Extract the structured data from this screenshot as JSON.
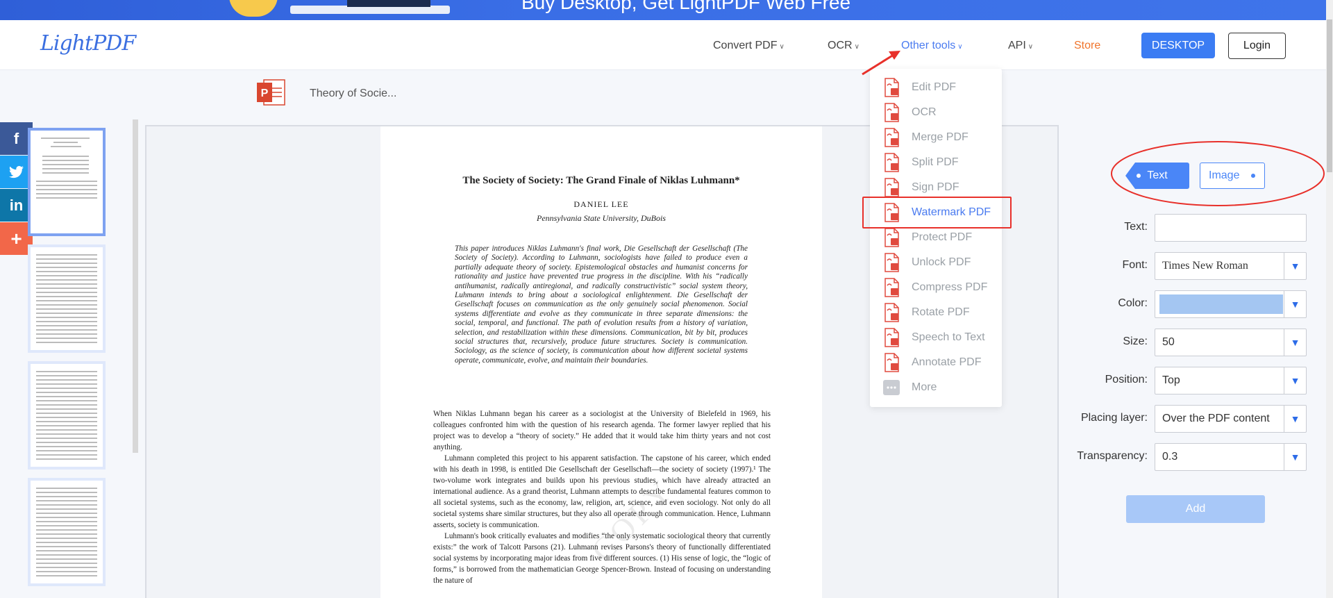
{
  "banner": {
    "text": "Buy Desktop, Get LightPDF Web Free"
  },
  "header": {
    "logo": "LightPDF",
    "nav": [
      {
        "label": "Convert PDF"
      },
      {
        "label": "OCR"
      },
      {
        "label": "Other tools"
      },
      {
        "label": "API"
      }
    ],
    "store": "Store",
    "desktop_button": "DESKTOP",
    "login_button": "Login"
  },
  "file": {
    "name": "Theory of Socie..."
  },
  "menu": {
    "items": [
      {
        "label": "Edit PDF",
        "icon": "edit-pdf-icon"
      },
      {
        "label": "OCR",
        "icon": "ocr-icon"
      },
      {
        "label": "Merge PDF",
        "icon": "merge-pdf-icon"
      },
      {
        "label": "Split PDF",
        "icon": "split-pdf-icon"
      },
      {
        "label": "Sign PDF",
        "icon": "sign-pdf-icon"
      },
      {
        "label": "Watermark PDF",
        "icon": "watermark-pdf-icon"
      },
      {
        "label": "Protect PDF",
        "icon": "protect-pdf-icon"
      },
      {
        "label": "Unlock PDF",
        "icon": "unlock-pdf-icon"
      },
      {
        "label": "Compress PDF",
        "icon": "compress-pdf-icon"
      },
      {
        "label": "Rotate PDF",
        "icon": "rotate-pdf-icon"
      },
      {
        "label": "Speech to Text",
        "icon": "speech-to-text-icon"
      },
      {
        "label": "Annotate PDF",
        "icon": "annotate-pdf-icon"
      },
      {
        "label": "More",
        "icon": "more-icon"
      }
    ]
  },
  "document": {
    "title": "The Society of Society: The Grand Finale of Niklas Luhmann*",
    "author": "DANIEL LEE",
    "affiliation": "Pennsylvania State University, DuBois",
    "abstract": "This paper introduces Niklas Luhmann's final work, Die Gesellschaft der Gesellschaft (The Society of Society). According to Luhmann, sociologists have failed to produce even a partially adequate theory of society. Epistemological obstacles and humanist concerns for rationality and justice have prevented true progress in the discipline. With his “radically antihumanist, radically antiregional, and radically constructivistic” social system theory, Luhmann intends to bring about a sociological enlightenment. Die Gesellschaft der Gesellschaft focuses on communication as the only genuinely social phenomenon. Social systems differentiate and evolve as they communicate in three separate dimensions: the social, temporal, and functional. The path of evolution results from a history of variation, selection, and restabilization within these dimensions. Communication, bit by bit, produces social structures that, recursively, produce future structures. Society is communication. Sociology, as the science of society, is communication about how different societal systems operate, communicate, evolve, and maintain their boundaries.",
    "paragraphs": [
      "When Niklas Luhmann began his career as a sociologist at the University of Bielefeld in 1969, his colleagues confronted him with the question of his research agenda. The former lawyer replied that his project was to develop a “theory of society.” He added that it would take him thirty years and not cost anything.",
      "Luhmann completed this project to his apparent satisfaction. The capstone of his career, which ended with his death in 1998, is entitled Die Gesellschaft der Gesellschaft—the society of society (1997).¹ The two-volume work integrates and builds upon his previous studies, which have already attracted an international audience. As a grand theorist, Luhmann attempts to describe fundamental features common to all societal systems, such as the economy, law, religion, art, science, and even sociology. Not only do all societal systems share similar structures, but they also all operate through communication. Hence, Luhmann asserts, society is communication.",
      "Luhmann's book critically evaluates and modifies “the only systematic sociological theory that currently exists:” the work of Talcott Parsons (21). Luhmann revises Parsons's theory of functionally differentiated social systems by incorporating major ideas from five different sources. (1) His sense of logic, the “logic of forms,” is borrowed from the mathematician George Spencer-Brown. Instead of focusing on understanding the nature of"
    ],
    "watermark": "COPY"
  },
  "panel": {
    "tab_text": "Text",
    "tab_image": "Image",
    "fields": [
      {
        "label": "Text:",
        "value": ""
      },
      {
        "label": "Font:",
        "value": "Times New Roman"
      },
      {
        "label": "Color:",
        "value": "#a4c6f2"
      },
      {
        "label": "Size:",
        "value": "50"
      },
      {
        "label": "Position:",
        "value": "Top"
      },
      {
        "label": "Placing layer:",
        "value": "Over the PDF content"
      },
      {
        "label": "Transparency:",
        "value": "0.3"
      }
    ],
    "add_button": "Add"
  },
  "colors": {
    "accent": "#4a86f7",
    "annotation": "#e8302a",
    "store": "#f0742b"
  }
}
